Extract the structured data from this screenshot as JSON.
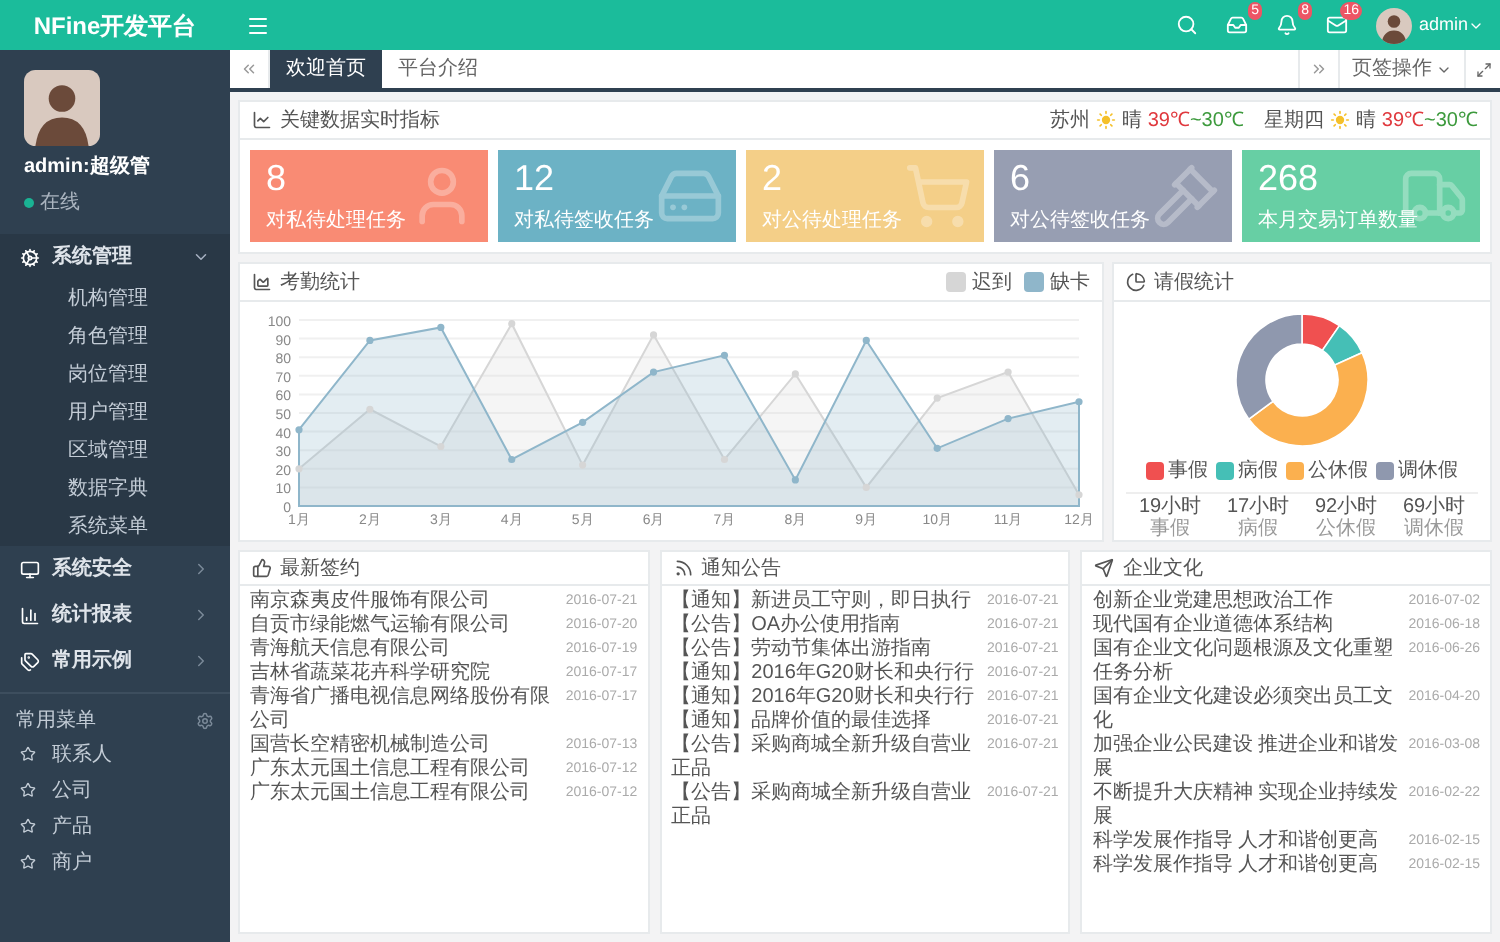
{
  "app": {
    "logo": "NFine开发平台"
  },
  "topbar": {
    "badges": [
      {
        "kind": "inbox",
        "count": "5"
      },
      {
        "kind": "bell",
        "count": "8"
      },
      {
        "kind": "mail",
        "count": "16"
      }
    ],
    "user": "admin"
  },
  "sidebar": {
    "user_name": "admin:超级管",
    "status": "在线",
    "menu": [
      {
        "label": "系统管理",
        "expanded": true,
        "children": [
          "机构管理",
          "角色管理",
          "岗位管理",
          "用户管理",
          "区域管理",
          "数据字典",
          "系统菜单"
        ]
      },
      {
        "label": "系统安全",
        "expanded": false
      },
      {
        "label": "统计报表",
        "expanded": false
      },
      {
        "label": "常用示例",
        "expanded": false
      }
    ],
    "favorites_title": "常用菜单",
    "favorites": [
      "联系人",
      "公司",
      "产品",
      "商户"
    ]
  },
  "tabs": [
    {
      "label": "欢迎首页",
      "selected": true
    },
    {
      "label": "平台介绍",
      "selected": false
    }
  ],
  "tab_actions": "页签操作",
  "metrics": {
    "title": "关键数据实时指标",
    "weather": [
      {
        "place": "苏州",
        "condition": "晴",
        "high": "39℃",
        "low": "~30℃"
      },
      {
        "place": "星期四",
        "condition": "晴",
        "high": "39℃",
        "low": "~30℃"
      }
    ],
    "stats": [
      {
        "value": "8",
        "label": "对私待处理任务",
        "color": "#f98b74"
      },
      {
        "value": "12",
        "label": "对私待签收任务",
        "color": "#6cb2c5"
      },
      {
        "value": "2",
        "label": "对公待处理任务",
        "color": "#f4cf88"
      },
      {
        "value": "6",
        "label": "对公待签收任务",
        "color": "#979eb2"
      },
      {
        "value": "268",
        "label": "本月交易订单数量",
        "color": "#67cfa4"
      }
    ]
  },
  "attendance": {
    "title": "考勤统计",
    "chart_data": {
      "type": "area",
      "grid": true,
      "categories": [
        "1月",
        "2月",
        "3月",
        "4月",
        "5月",
        "6月",
        "7月",
        "8月",
        "9月",
        "10月",
        "11月",
        "12月"
      ],
      "ylim": [
        0,
        100
      ],
      "yticks": [
        0,
        10,
        20,
        30,
        40,
        50,
        60,
        70,
        80,
        90,
        100
      ],
      "series": [
        {
          "name": "迟到",
          "color": "#d6d6d6",
          "values": [
            20,
            52,
            32,
            98,
            22,
            92,
            25,
            71,
            10,
            58,
            72,
            6
          ]
        },
        {
          "name": "缺卡",
          "color": "#8fb6ca",
          "values": [
            41,
            89,
            96,
            25,
            45,
            72,
            81,
            14,
            89,
            31,
            47,
            56
          ]
        }
      ]
    }
  },
  "leave": {
    "title": "请假统计",
    "chart_data": {
      "type": "donut",
      "values": [
        9.6,
        8.6,
        46.7,
        35.1
      ]
    },
    "legend": [
      {
        "label": "事假",
        "color": "#f05050"
      },
      {
        "label": "病假",
        "color": "#45bfb6"
      },
      {
        "label": "公休假",
        "color": "#fbb04f"
      },
      {
        "label": "调休假",
        "color": "#8f98ae"
      }
    ],
    "summary": [
      {
        "value": "19小时",
        "label": "事假"
      },
      {
        "value": "17小时",
        "label": "病假"
      },
      {
        "value": "92小时",
        "label": "公休假"
      },
      {
        "value": "69小时",
        "label": "调休假"
      }
    ]
  },
  "panels": [
    {
      "title": "最新签约",
      "rows": [
        {
          "text": "南京森夷皮件服饰有限公司",
          "date": "2016-07-21"
        },
        {
          "text": "自贡市绿能燃气运输有限公司",
          "date": "2016-07-20"
        },
        {
          "text": "青海航天信息有限公司",
          "date": "2016-07-19"
        },
        {
          "text": "吉林省蔬菜花卉科学研究院",
          "date": "2016-07-17"
        },
        {
          "text": "青海省广播电视信息网络股份有限公司",
          "date": "2016-07-17"
        },
        {
          "text": "国营长空精密机械制造公司",
          "date": "2016-07-13"
        },
        {
          "text": "广东太元国土信息工程有限公司",
          "date": "2016-07-12"
        },
        {
          "text": "广东太元国土信息工程有限公司",
          "date": "2016-07-12"
        }
      ]
    },
    {
      "title": "通知公告",
      "rows": [
        {
          "text": "【通知】新进员工守则，即日执行",
          "date": "2016-07-21"
        },
        {
          "text": "【公告】OA办公使用指南",
          "date": "2016-07-21"
        },
        {
          "text": "【公告】劳动节集体出游指南",
          "date": "2016-07-21"
        },
        {
          "text": "【通知】2016年G20财长和央行行",
          "date": "2016-07-21"
        },
        {
          "text": "【通知】2016年G20财长和央行行",
          "date": "2016-07-21"
        },
        {
          "text": "【通知】品牌价值的最佳选择",
          "date": "2016-07-21"
        },
        {
          "text": "【公告】采购商城全新升级自营业正品",
          "date": "2016-07-21"
        },
        {
          "text": "【公告】采购商城全新升级自营业正品",
          "date": "2016-07-21"
        }
      ]
    },
    {
      "title": "企业文化",
      "rows": [
        {
          "text": "创新企业党建思想政治工作",
          "date": "2016-07-02"
        },
        {
          "text": "现代国有企业道德体系结构",
          "date": "2016-06-18"
        },
        {
          "text": "国有企业文化问题根源及文化重塑任务分析",
          "date": "2016-06-26"
        },
        {
          "text": "国有企业文化建设必须突出员工文化",
          "date": "2016-04-20"
        },
        {
          "text": "加强企业公民建设 推进企业和谐发展",
          "date": "2016-03-08"
        },
        {
          "text": "不断提升大庆精神 实现企业持续发展",
          "date": "2016-02-22"
        },
        {
          "text": "科学发展作指导 人才和谐创更高",
          "date": "2016-02-15"
        },
        {
          "text": "科学发展作指导 人才和谐创更高",
          "date": "2016-02-15"
        }
      ]
    }
  ]
}
